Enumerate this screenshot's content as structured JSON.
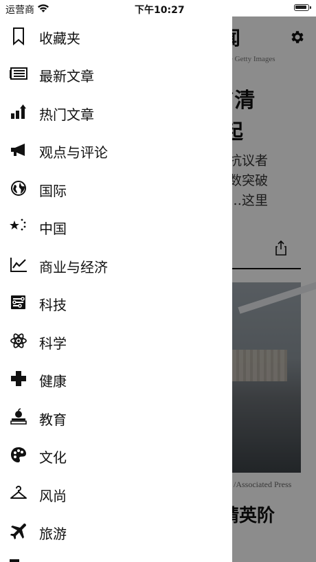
{
  "status_bar": {
    "carrier": "运营商",
    "time": "下午10:27"
  },
  "article": {
    "header_char": "闻",
    "credit": "e    Getty Images",
    "headline": "“清\n起",
    "summary": "港抗议者\n人数突破\n……这里",
    "photo_credit": "/Associated Press",
    "next_headline": "精英阶"
  },
  "drawer": {
    "items": [
      {
        "label": "收藏夹",
        "icon": "bookmark-icon"
      },
      {
        "label": "最新文章",
        "icon": "newspaper-icon"
      },
      {
        "label": "热门文章",
        "icon": "trending-icon"
      },
      {
        "label": "观点与评论",
        "icon": "megaphone-icon"
      },
      {
        "label": "国际",
        "icon": "globe-icon"
      },
      {
        "label": "中国",
        "icon": "stars-icon"
      },
      {
        "label": "商业与经济",
        "icon": "chart-icon"
      },
      {
        "label": "科技",
        "icon": "circuit-icon"
      },
      {
        "label": "科学",
        "icon": "atom-icon"
      },
      {
        "label": "健康",
        "icon": "cross-icon"
      },
      {
        "label": "教育",
        "icon": "books-apple-icon"
      },
      {
        "label": "文化",
        "icon": "palette-icon"
      },
      {
        "label": "风尚",
        "icon": "hanger-icon"
      },
      {
        "label": "旅游",
        "icon": "airplane-icon"
      }
    ]
  }
}
